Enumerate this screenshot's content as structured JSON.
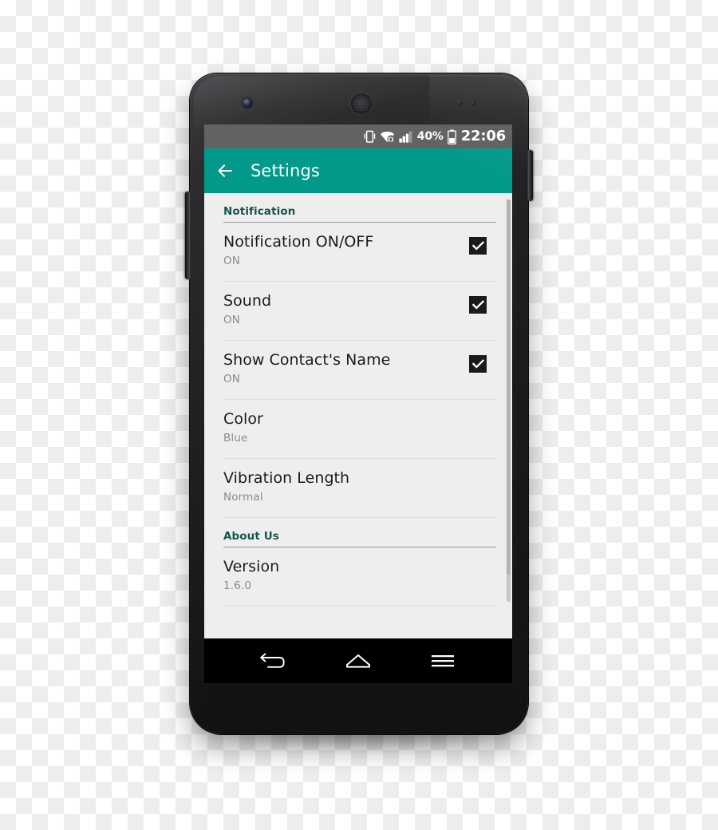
{
  "device": {
    "name": "android-smartphone",
    "hardware": {
      "front_camera": "front-camera",
      "earpiece": "earpiece-speaker",
      "proximity_sensor": "proximity-sensor",
      "light_sensor": "ambient-light-sensor",
      "volume_rocker": "volume-rocker",
      "power_button": "power-button"
    }
  },
  "colors": {
    "accent_teal": "#00998A",
    "section_header": "#17564C",
    "status_bar": "#636363",
    "screen_background": "#EEEEEE",
    "nav_bar": "#000000",
    "title_text": "#1B1B1B",
    "summary_text": "#8A8A8A"
  },
  "status_bar": {
    "icons": [
      "vibrate-icon",
      "wifi-secured-icon",
      "signal-bars-icon",
      "battery-icon"
    ],
    "battery_percent": "40%",
    "clock": "22:06"
  },
  "app_bar": {
    "back_icon": "arrow-left-icon",
    "title": "Settings"
  },
  "sections": [
    {
      "header": "Notification",
      "rows": [
        {
          "title": "Notification ON/OFF",
          "summary": "ON",
          "widget": "checkbox",
          "checked": true
        },
        {
          "title": "Sound",
          "summary": "ON",
          "widget": "checkbox",
          "checked": true
        },
        {
          "title": "Show Contact's Name",
          "summary": "ON",
          "widget": "checkbox",
          "checked": true
        },
        {
          "title": "Color",
          "summary": "Blue",
          "widget": "none",
          "checked": false
        },
        {
          "title": "Vibration Length",
          "summary": "Normal",
          "widget": "none",
          "checked": false
        }
      ]
    },
    {
      "header": "About Us",
      "rows": [
        {
          "title": "Version",
          "summary": "1.6.0",
          "widget": "none",
          "checked": false
        }
      ]
    }
  ],
  "scrollbar": {
    "name": "vertical-scrollbar"
  },
  "nav_bar": {
    "buttons": [
      {
        "icon": "back-icon",
        "label": "Back"
      },
      {
        "icon": "home-icon",
        "label": "Home"
      },
      {
        "icon": "menu-icon",
        "label": "Menu"
      }
    ]
  }
}
